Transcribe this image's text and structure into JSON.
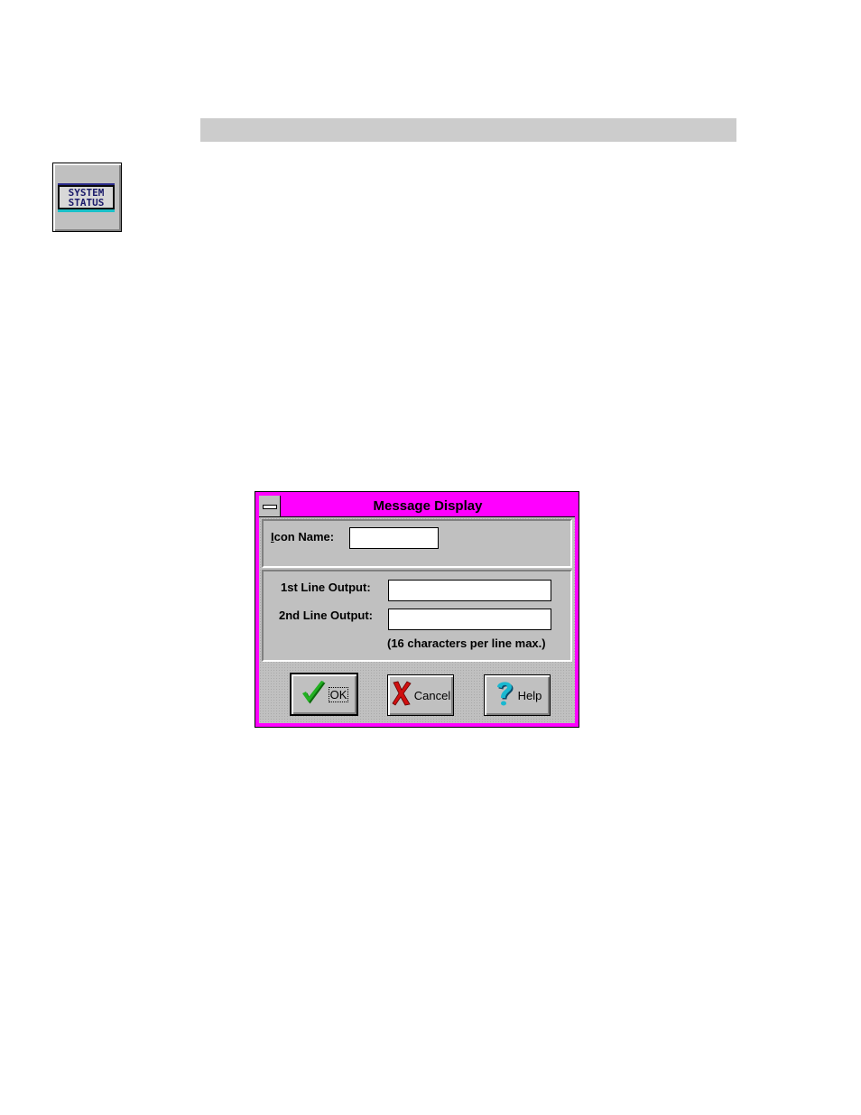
{
  "icon": {
    "line1": "SYSTEM",
    "line2": "STATUS",
    "name": "system-status-icon"
  },
  "dialog": {
    "title": "Message Display",
    "icon_name_label_prefix": "I",
    "icon_name_label_rest": "con Name:",
    "icon_name_value": "",
    "line1_label": "1st Line Output:",
    "line1_value": "",
    "line2_label": "2nd Line Output:",
    "line2_value": "",
    "note": "(16 characters per line max.)",
    "buttons": {
      "ok": "OK",
      "cancel": "Cancel",
      "help": "Help"
    }
  },
  "colors": {
    "titlebar": "#ff00ff",
    "dialog_face": "#c0c0c0",
    "ok_check": "#1aa01a",
    "cancel_x": "#d01010",
    "help_q": "#18b0c8"
  }
}
